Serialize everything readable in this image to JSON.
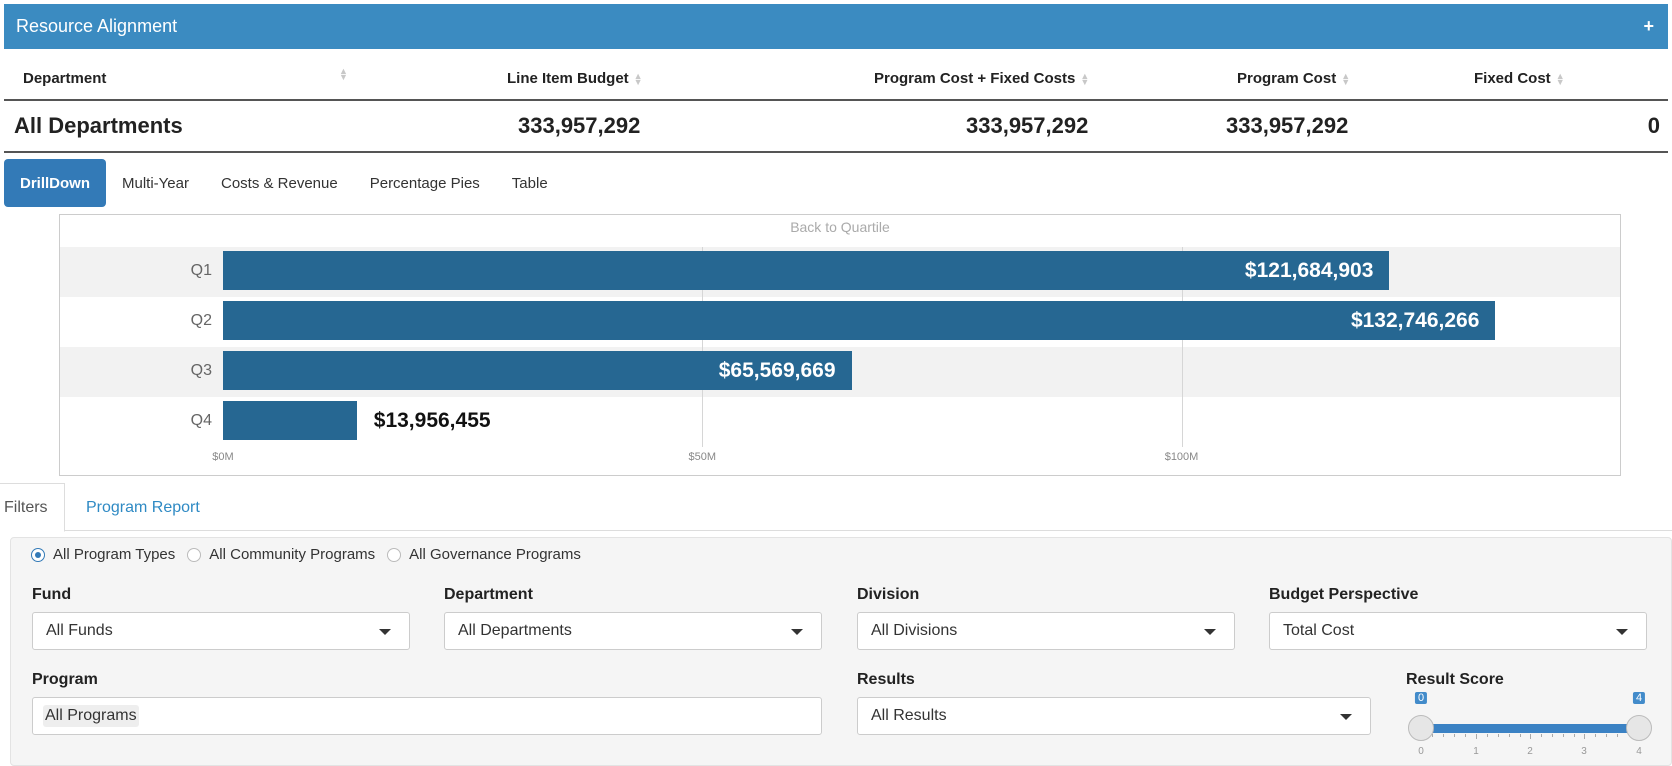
{
  "panel": {
    "title": "Resource Alignment",
    "plus": "+"
  },
  "summary": {
    "headers": [
      "Department",
      "Line Item Budget",
      "Program Cost + Fixed Costs",
      "Program Cost",
      "Fixed Cost"
    ],
    "row": {
      "department": "All Departments",
      "line_item_budget": "333,957,292",
      "program_plus_fixed": "333,957,292",
      "program_cost": "333,957,292",
      "fixed_cost": "0"
    }
  },
  "tabs": [
    "DrillDown",
    "Multi-Year",
    "Costs & Revenue",
    "Percentage Pies",
    "Table"
  ],
  "active_tab": "DrillDown",
  "chart": {
    "back_link": "Back to Quartile"
  },
  "chart_data": {
    "type": "bar",
    "orientation": "horizontal",
    "categories": [
      "Q1",
      "Q2",
      "Q3",
      "Q4"
    ],
    "values": [
      121684903,
      132746266,
      65569669,
      13956455
    ],
    "value_labels": [
      "$121,684,903",
      "$132,746,266",
      "$65,569,669",
      "$13,956,455"
    ],
    "x_ticks": [
      "$0M",
      "$50M",
      "$100M"
    ],
    "xlim": [
      0,
      145640000
    ],
    "bar_color": "#266792",
    "grid": true
  },
  "subtabs": {
    "filters": "Filters",
    "program_report": "Program Report"
  },
  "filters": {
    "radios": [
      {
        "label": "All Program Types",
        "checked": true
      },
      {
        "label": "All Community Programs",
        "checked": false
      },
      {
        "label": "All Governance Programs",
        "checked": false
      }
    ],
    "fund": {
      "label": "Fund",
      "value": "All Funds"
    },
    "department": {
      "label": "Department",
      "value": "All Departments"
    },
    "division": {
      "label": "Division",
      "value": "All Divisions"
    },
    "budget_perspective": {
      "label": "Budget Perspective",
      "value": "Total Cost"
    },
    "program": {
      "label": "Program",
      "value": "All Programs"
    },
    "results": {
      "label": "Results",
      "value": "All Results"
    },
    "result_score": {
      "label": "Result Score",
      "min": "0",
      "max": "4",
      "ticks": [
        "0",
        "1",
        "2",
        "3",
        "4"
      ],
      "range": [
        0,
        4
      ]
    }
  }
}
